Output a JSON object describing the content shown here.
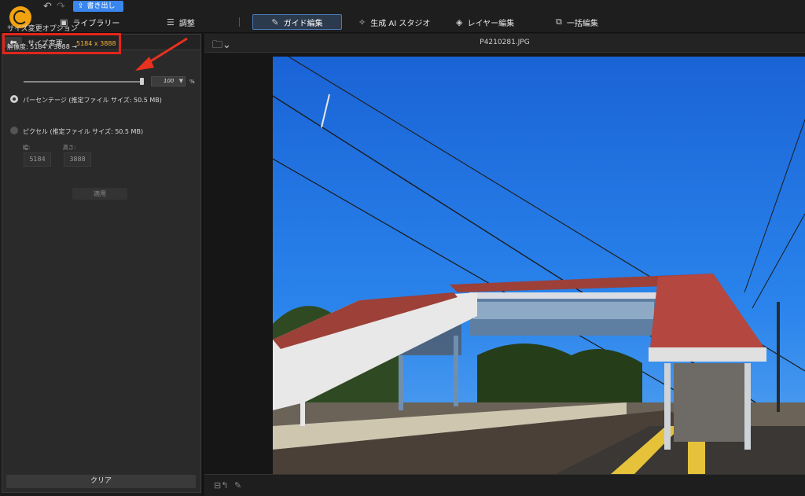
{
  "colors": {
    "accent": "#3a86ef",
    "highlight_box": "#e2251b",
    "new_resolution": "#f3b43a",
    "sky": "#1f6fe0",
    "roof": "#b4473f"
  },
  "toolbar": {
    "undo_icon": "undo-arrow",
    "redo_icon": "redo-arrow",
    "export_label": "書き出し"
  },
  "nav": {
    "tabs": [
      {
        "label": "ライブラリー",
        "icon": "library-icon"
      },
      {
        "label": "調整",
        "icon": "sliders-icon"
      },
      {
        "label": "ガイド編集",
        "icon": "magic-wand-icon",
        "active": true
      },
      {
        "label": "生成 AI スタジオ",
        "icon": "sparkle-icon"
      },
      {
        "label": "レイヤー編集",
        "icon": "layers-icon"
      },
      {
        "label": "一括編集",
        "icon": "batch-icon"
      }
    ]
  },
  "panel": {
    "title": "サイズ変更",
    "options_title": "サイズ変更オプション",
    "resolution_label": "解像度:",
    "resolution_old": "5184 x 3888",
    "resolution_arrow": "→",
    "resolution_new": "5184 x 3888",
    "percentage_label": "パーセンテージ (推定ファイル サイズ: 50.5 MB)",
    "percentage_selected": true,
    "percentage_value": "100",
    "percent_sign": "%",
    "pixel_label": "ピクセル (推定ファイル サイズ: 50.5 MB)",
    "width_label": "幅:",
    "height_label": "高さ:",
    "width_value": "5184",
    "height_value": "3888",
    "apply_label": "適用",
    "clear_label": "クリア"
  },
  "viewer": {
    "file_name": "P4210281.JPG"
  }
}
